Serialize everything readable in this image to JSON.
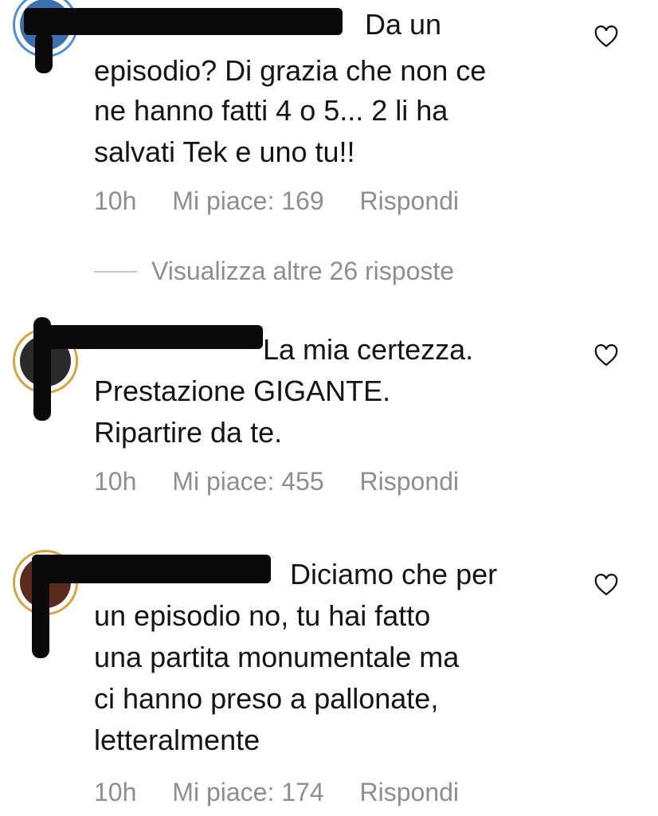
{
  "comments": [
    {
      "text_lines": [
        "Da un",
        "episodio? Di grazia che non ce",
        "ne hanno fatti 4 o 5... 2 li ha",
        "salvati Tek e uno tu!!"
      ],
      "time": "10h",
      "likes": "Mi piace: 169",
      "reply": "Rispondi"
    },
    {
      "text_lines": [
        "La mia certezza.",
        "Prestazione GIGANTE.",
        "Ripartire da te."
      ],
      "time": "10h",
      "likes": "Mi piace: 455",
      "reply": "Rispondi"
    },
    {
      "text_lines": [
        "Diciamo che per",
        "un episodio no, tu hai fatto",
        "una partita monumentale ma",
        "ci hanno preso a pallonate,",
        "letteralmente"
      ],
      "time": "10h",
      "likes": "Mi piace: 174",
      "reply": "Rispondi"
    }
  ],
  "view_more": "Visualizza altre 26 risposte",
  "icons": {
    "like": "heart-outline-icon"
  },
  "colors": {
    "meta": "#8e8e8e",
    "text": "#141414",
    "redaction": "#0a0a0a"
  }
}
